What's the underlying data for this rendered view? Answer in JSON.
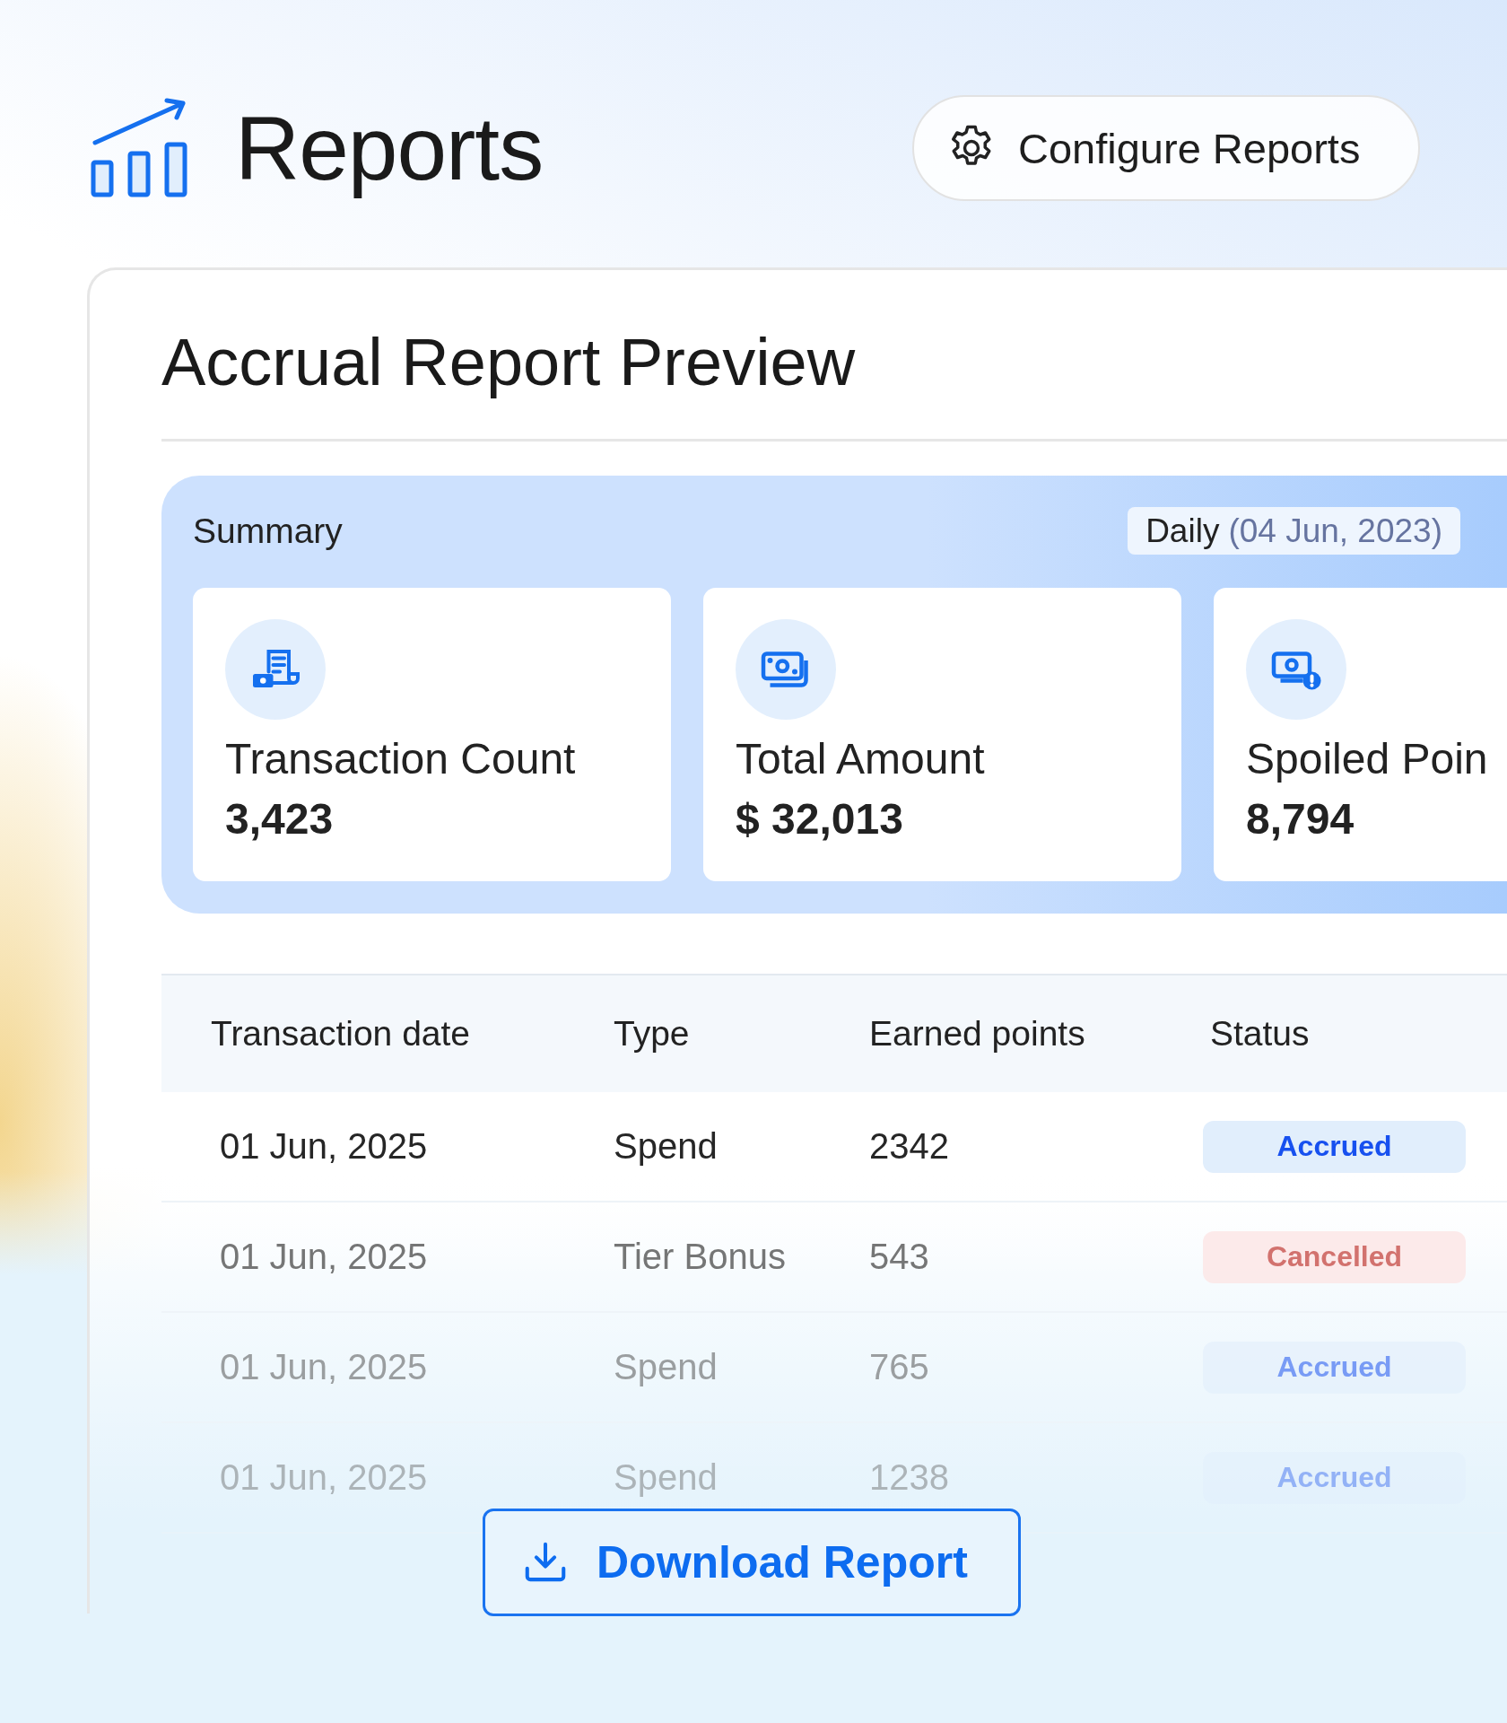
{
  "header": {
    "title": "Reports",
    "configure_button": "Configure Reports"
  },
  "report": {
    "title": "Accrual Report Preview",
    "summary": {
      "title": "Summary",
      "period": "Daily",
      "date": "(04 Jun, 2023)",
      "cards": [
        {
          "kind": "receipt",
          "label": "Transaction Count",
          "value": "3,423"
        },
        {
          "kind": "money",
          "label": "Total Amount",
          "value": "$ 32,013"
        },
        {
          "kind": "alert",
          "label": "Spoiled Poin",
          "value": "8,794"
        }
      ]
    },
    "table": {
      "columns": [
        "Transaction date",
        "Type",
        "Earned points",
        "Status"
      ],
      "rows": [
        {
          "date": "01 Jun, 2025",
          "type": "Spend",
          "points": "2342",
          "status": {
            "kind": "accrued",
            "label": "Accrued"
          }
        },
        {
          "date": "01 Jun, 2025",
          "type": "Tier Bonus",
          "points": "543",
          "status": {
            "kind": "cancelled",
            "label": "Cancelled"
          }
        },
        {
          "date": "01 Jun, 2025",
          "type": "Spend",
          "points": "765",
          "status": {
            "kind": "accrued",
            "label": "Accrued"
          }
        },
        {
          "date": "01 Jun, 2025",
          "type": "Spend",
          "points": "1238",
          "status": {
            "kind": "accrued",
            "label": "Accrued"
          }
        }
      ]
    }
  },
  "download_button": "Download Report"
}
